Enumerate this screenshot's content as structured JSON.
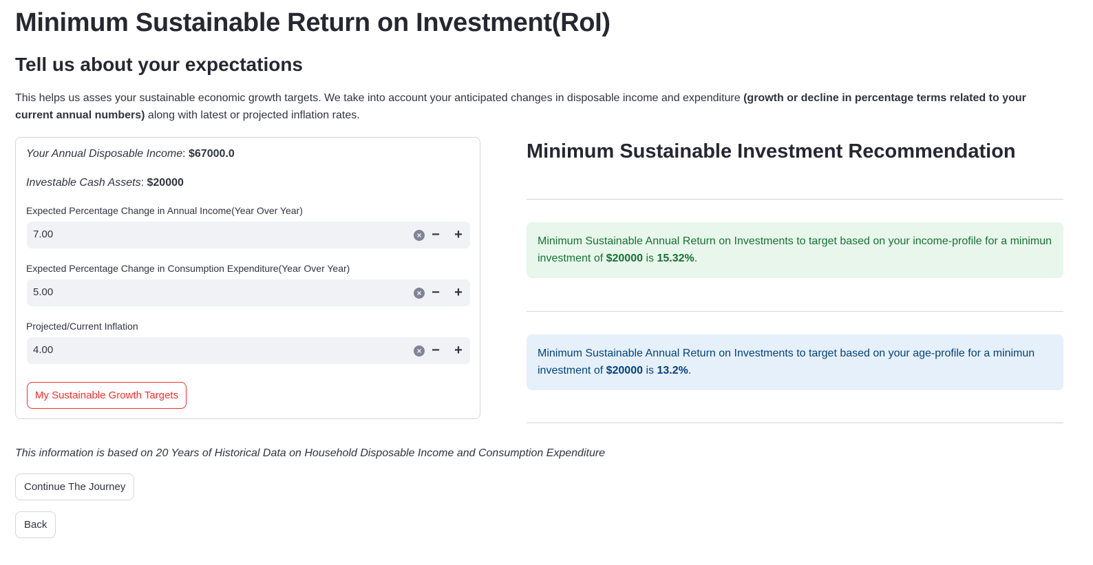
{
  "page": {
    "title": "Minimum Sustainable Return on Investment(RoI)",
    "subtitle": "Tell us about your expectations",
    "intro_text": "This helps us asses your sustainable economic growth targets. We take into account your anticipated changes in disposable income and expenditure ",
    "intro_bold": "(growth or decline in percentage terms related to your current annual numbers)",
    "intro_tail": " along with latest or projected inflation rates."
  },
  "form": {
    "income_label": "Your Annual Disposable Income",
    "income_value": "$67000.0",
    "assets_label": "Investable Cash Assets",
    "assets_value": "$20000",
    "fields": [
      {
        "label": "Expected Percentage Change in Annual Income(Year Over Year)",
        "value": "7.00"
      },
      {
        "label": "Expected Percentage Change in Consumption Expenditure(Year Over Year)",
        "value": "5.00"
      },
      {
        "label": "Projected/Current Inflation",
        "value": "4.00"
      }
    ],
    "clear_icon": "×",
    "minus_icon": "−",
    "plus_icon": "+",
    "submit_label": "My Sustainable Growth Targets"
  },
  "recommendation": {
    "title": "Minimum Sustainable Investment Recommendation",
    "income_pre": "Minimum Sustainable Annual Return on Investments to target based on your income-profile for a minimun investment of ",
    "income_amount": "$20000",
    "income_mid": " is ",
    "income_pct": "15.32%",
    "income_end": ".",
    "age_pre": "Minimum Sustainable Annual Return on Investments to target based on your age-profile for a minimun investment of ",
    "age_amount": "$20000",
    "age_mid": " is ",
    "age_pct": "13.2%",
    "age_end": "."
  },
  "footer": {
    "note": "This information is based on 20 Years of Historical Data on Household Disposable Income and Consumption Expenditure",
    "continue_label": "Continue The Journey",
    "back_label": "Back"
  },
  "colors": {
    "primary": "#ff2b2b",
    "success_bg": "#e8f6ec",
    "success_text": "#177233",
    "info_bg": "#e6f0fa",
    "info_text": "#004280"
  }
}
